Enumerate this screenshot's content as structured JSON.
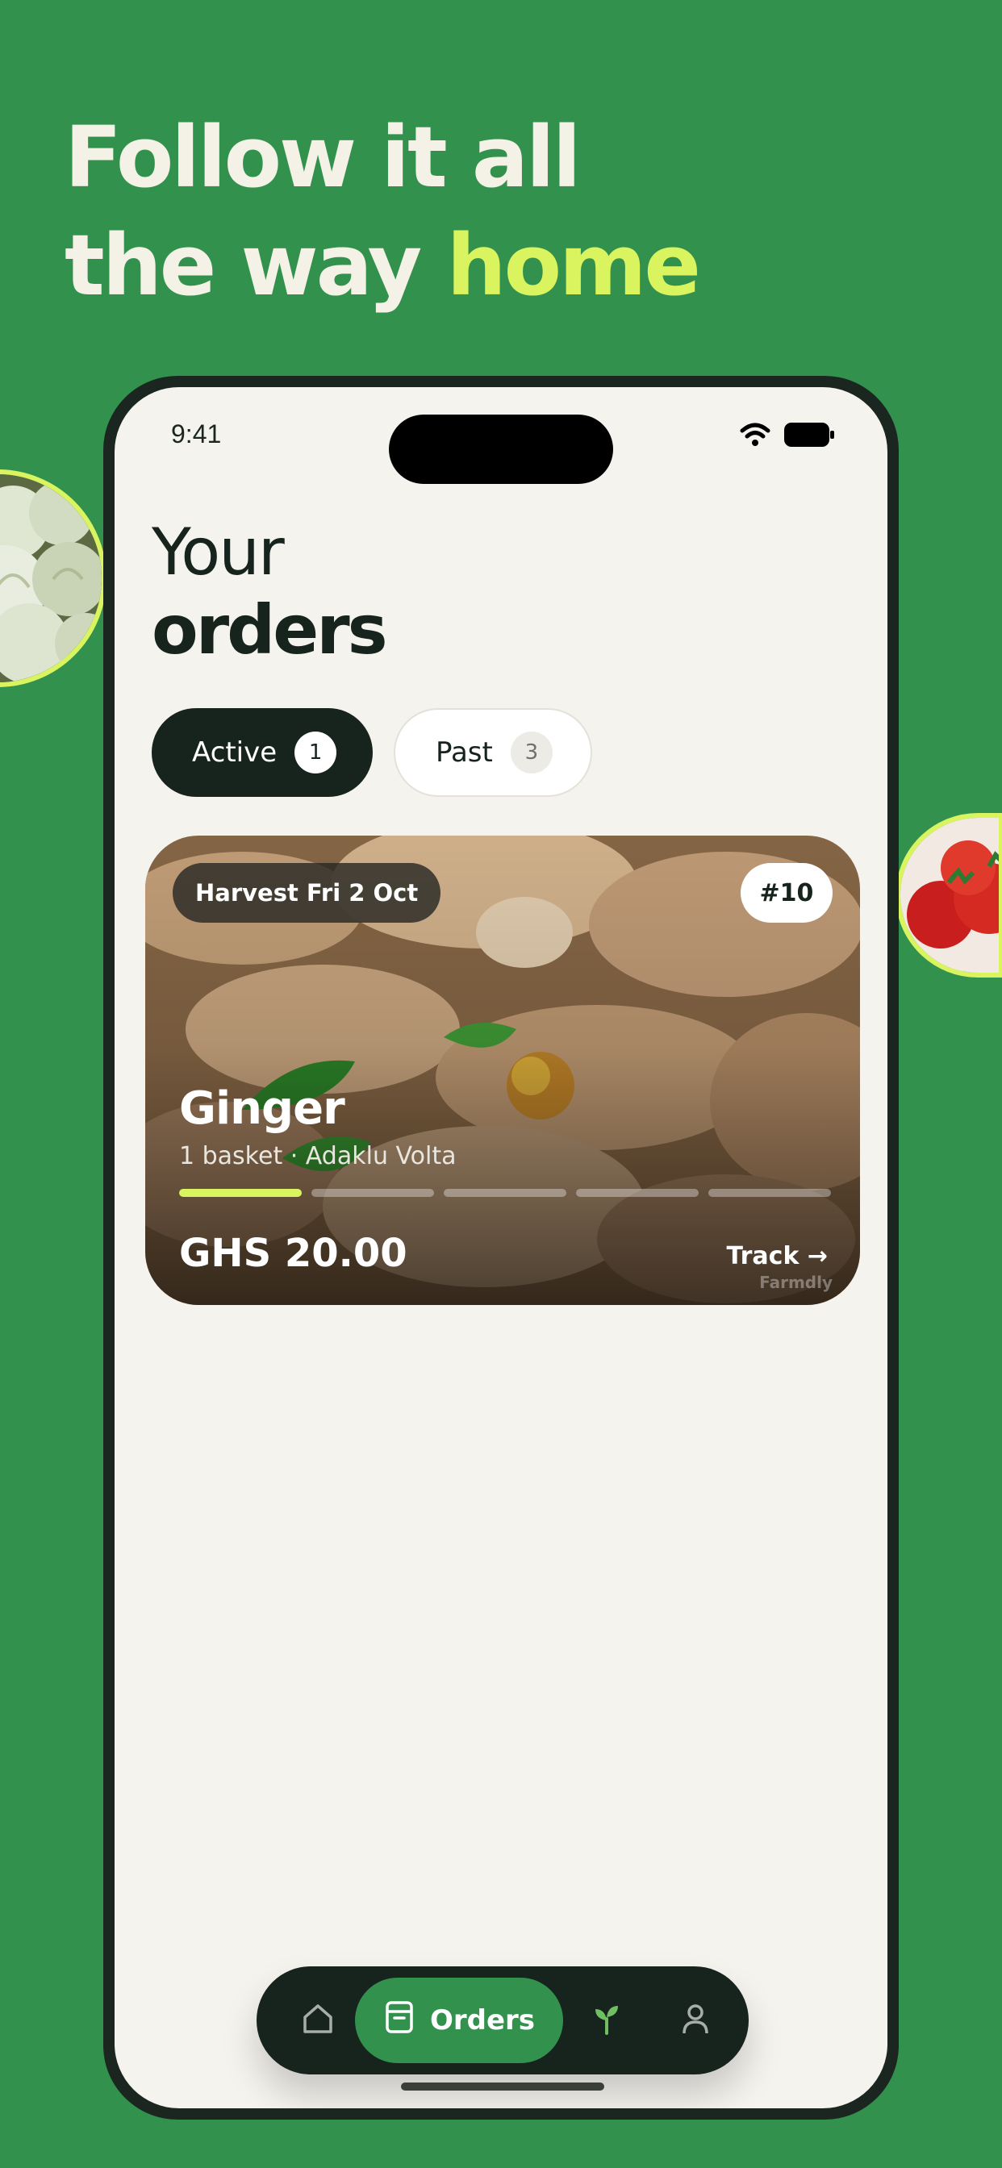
{
  "headline": {
    "line1": "Follow it all",
    "line2_prefix": "the way ",
    "line2_accent": "home"
  },
  "status_bar": {
    "time": "9:41"
  },
  "page": {
    "title_light": "Your",
    "title_bold": "orders"
  },
  "tabs": [
    {
      "label": "Active",
      "count": "1",
      "selected": true
    },
    {
      "label": "Past",
      "count": "3",
      "selected": false
    }
  ],
  "order_card": {
    "harvest": "Harvest Fri 2 Oct",
    "order_number": "#10",
    "product": "Ginger",
    "meta": "1 basket · Adaklu Volta",
    "progress_steps_total": 5,
    "progress_steps_done": 1,
    "price": "GHS 20.00",
    "action": "Track →",
    "watermark": "Farmdly"
  },
  "nav": {
    "orders_label": "Orders",
    "active": "orders"
  },
  "colors": {
    "brand_green": "#33914e",
    "accent_lime": "#d9f45e",
    "dark": "#17231d",
    "screen_bg": "#f5f3ee"
  }
}
